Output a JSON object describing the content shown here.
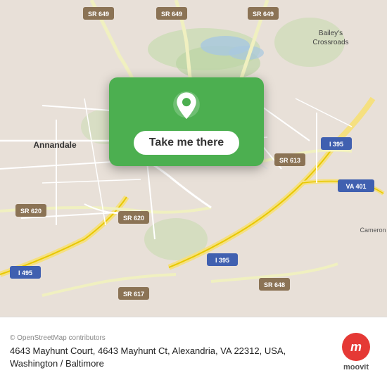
{
  "map": {
    "center_lat": 38.82,
    "center_lng": -77.15,
    "area": "Annandale / Alexandria, VA",
    "bg_color": "#e8e0d8"
  },
  "card": {
    "button_label": "Take me there"
  },
  "bottom_bar": {
    "osm_credit": "© OpenStreetMap contributors",
    "address": "4643 Mayhunt Court, 4643 Mayhunt Ct, Alexandria, VA 22312, USA, Washington / Baltimore",
    "moovit_label": "moovit"
  },
  "roads": {
    "route_labels": [
      "SR 649",
      "SR 649",
      "SR 649",
      "SR 613",
      "SR 620",
      "SR 620",
      "SR 617",
      "SR 648",
      "I 495",
      "I 395",
      "I 395",
      "VA 401"
    ]
  }
}
